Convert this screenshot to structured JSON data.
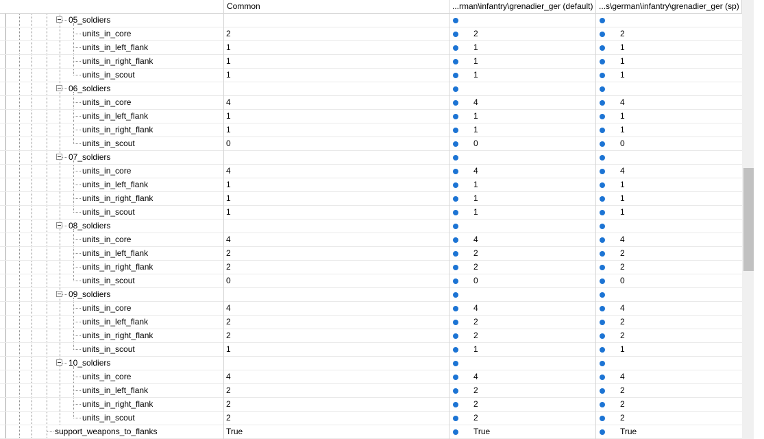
{
  "columns": [
    {
      "label": "Common"
    },
    {
      "label": "...rman\\infantry\\grenadier_ger (default)"
    },
    {
      "label": "...s\\german\\infantry\\grenadier_ger (sp)"
    }
  ],
  "groups": [
    {
      "name": "05_soldiers",
      "children": [
        {
          "name": "units_in_core",
          "values": [
            "2",
            "2",
            "2"
          ]
        },
        {
          "name": "units_in_left_flank",
          "values": [
            "1",
            "1",
            "1"
          ]
        },
        {
          "name": "units_in_right_flank",
          "values": [
            "1",
            "1",
            "1"
          ]
        },
        {
          "name": "units_in_scout",
          "values": [
            "1",
            "1",
            "1"
          ]
        }
      ]
    },
    {
      "name": "06_soldiers",
      "children": [
        {
          "name": "units_in_core",
          "values": [
            "4",
            "4",
            "4"
          ]
        },
        {
          "name": "units_in_left_flank",
          "values": [
            "1",
            "1",
            "1"
          ]
        },
        {
          "name": "units_in_right_flank",
          "values": [
            "1",
            "1",
            "1"
          ]
        },
        {
          "name": "units_in_scout",
          "values": [
            "0",
            "0",
            "0"
          ]
        }
      ]
    },
    {
      "name": "07_soldiers",
      "children": [
        {
          "name": "units_in_core",
          "values": [
            "4",
            "4",
            "4"
          ]
        },
        {
          "name": "units_in_left_flank",
          "values": [
            "1",
            "1",
            "1"
          ]
        },
        {
          "name": "units_in_right_flank",
          "values": [
            "1",
            "1",
            "1"
          ]
        },
        {
          "name": "units_in_scout",
          "values": [
            "1",
            "1",
            "1"
          ]
        }
      ]
    },
    {
      "name": "08_soldiers",
      "children": [
        {
          "name": "units_in_core",
          "values": [
            "4",
            "4",
            "4"
          ]
        },
        {
          "name": "units_in_left_flank",
          "values": [
            "2",
            "2",
            "2"
          ]
        },
        {
          "name": "units_in_right_flank",
          "values": [
            "2",
            "2",
            "2"
          ]
        },
        {
          "name": "units_in_scout",
          "values": [
            "0",
            "0",
            "0"
          ]
        }
      ]
    },
    {
      "name": "09_soldiers",
      "children": [
        {
          "name": "units_in_core",
          "values": [
            "4",
            "4",
            "4"
          ]
        },
        {
          "name": "units_in_left_flank",
          "values": [
            "2",
            "2",
            "2"
          ]
        },
        {
          "name": "units_in_right_flank",
          "values": [
            "2",
            "2",
            "2"
          ]
        },
        {
          "name": "units_in_scout",
          "values": [
            "1",
            "1",
            "1"
          ]
        }
      ]
    },
    {
      "name": "10_soldiers",
      "children": [
        {
          "name": "units_in_core",
          "values": [
            "4",
            "4",
            "4"
          ]
        },
        {
          "name": "units_in_left_flank",
          "values": [
            "2",
            "2",
            "2"
          ]
        },
        {
          "name": "units_in_right_flank",
          "values": [
            "2",
            "2",
            "2"
          ]
        },
        {
          "name": "units_in_scout",
          "values": [
            "2",
            "2",
            "2"
          ]
        }
      ]
    }
  ],
  "trailing": {
    "name": "support_weapons_to_flanks",
    "values": [
      "True",
      "True",
      "True"
    ]
  },
  "colors": {
    "accent_dot": "#1c74d4",
    "grid_line": "#d6d6d6"
  },
  "scrollbar": {
    "position_fraction": 0.5
  }
}
